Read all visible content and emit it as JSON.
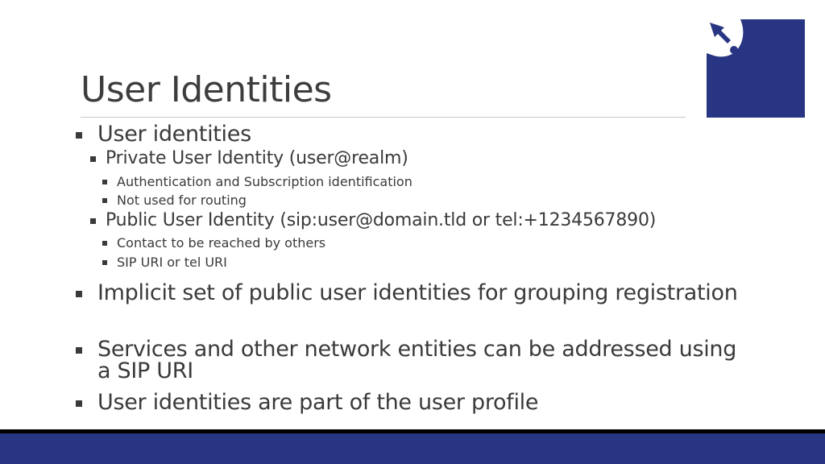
{
  "slide": {
    "title": "User Identities",
    "colors": {
      "accent": "#283582",
      "text": "#3a3a3a",
      "rule": "#c8c8c8"
    },
    "logo_icon": "arrow-into-circle-logo",
    "bullets": {
      "b1": "User identities",
      "b1_1": "Private User Identity (user@realm)",
      "b1_1_1": "Authentication and Subscription identification",
      "b1_1_2": "Not used for routing",
      "b1_2": "Public User Identity (sip:user@domain.tld or tel:+1234567890)",
      "b1_2_1": "Contact to be reached by others",
      "b1_2_2": "SIP URI or tel URI",
      "b2": "Implicit set of public user identities for grouping registration",
      "b3": "Services and other network entities can be addressed using a SIP URI",
      "b4": "User identities are part of the user profile"
    }
  }
}
